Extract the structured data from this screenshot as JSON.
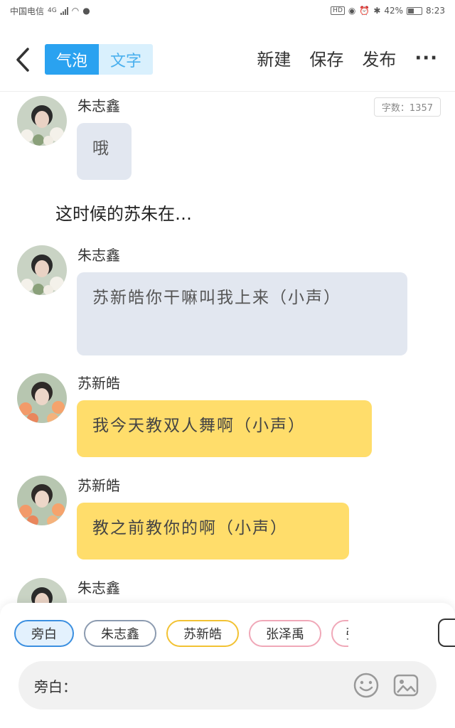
{
  "status_bar": {
    "carrier": "中国电信",
    "network": "4G",
    "battery": "42%",
    "time": "8:23"
  },
  "top_bar": {
    "back_icon": "chevron-left-icon",
    "mode_tabs": [
      "气泡",
      "文字"
    ],
    "active_tab": "气泡",
    "actions": [
      "新建",
      "保存",
      "发布"
    ],
    "more_icon": "more-dots-icon"
  },
  "chat": {
    "word_count_label": "字数：1357",
    "messages": [
      {
        "sender": "朱志鑫",
        "text": "哦",
        "style": "grey"
      },
      {
        "narration": "这时候的苏朱在…"
      },
      {
        "sender": "朱志鑫",
        "text": "苏新皓你干嘛叫我上来（小声）",
        "style": "grey"
      },
      {
        "sender": "苏新皓",
        "text": "我今天教双人舞啊（小声）",
        "style": "yellow"
      },
      {
        "sender": "苏新皓",
        "text": "教之前教你的啊（小声）",
        "style": "yellow"
      },
      {
        "sender": "朱志鑫",
        "text": "",
        "style": "grey"
      }
    ]
  },
  "roles": {
    "items": [
      "旁白",
      "朱志鑫",
      "苏新皓",
      "张泽禹",
      "张"
    ],
    "selected": "旁白"
  },
  "input": {
    "label": "旁白：",
    "value": "",
    "placeholder": "",
    "emoji_icon": "smiley-icon",
    "image_icon": "image-icon"
  },
  "colors": {
    "accent": "#2aa2f0",
    "grey_bubble": "#e2e7f0",
    "yellow_bubble": "#ffdd6b"
  }
}
